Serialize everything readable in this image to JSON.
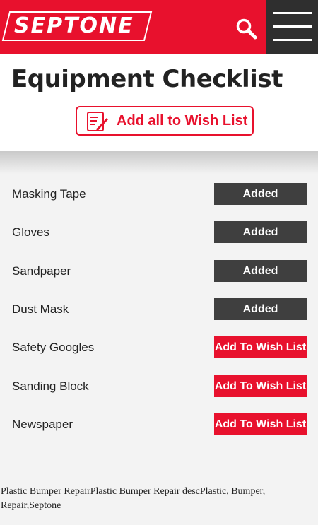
{
  "header": {
    "logo_text": "SEPTONE",
    "search_icon": "search-icon",
    "menu_icon": "hamburger-menu-icon",
    "brand_color": "#e8112d"
  },
  "title": "Equipment Checklist",
  "add_all": {
    "label": "Add all to Wish List",
    "icon": "checklist-pen-icon"
  },
  "items": [
    {
      "name": "Masking Tape",
      "button": "Added",
      "state": "added"
    },
    {
      "name": "Gloves",
      "button": "Added",
      "state": "added"
    },
    {
      "name": "Sandpaper",
      "button": "Added",
      "state": "added"
    },
    {
      "name": "Dust Mask",
      "button": "Added",
      "state": "added"
    },
    {
      "name": "Safety Googles",
      "button": "Add To Wish List",
      "state": "wish"
    },
    {
      "name": "Sanding Block",
      "button": "Add To Wish List",
      "state": "wish"
    },
    {
      "name": "Newspaper",
      "button": "Add To Wish List",
      "state": "wish"
    }
  ],
  "footer_text": "Plastic Bumper RepairPlastic Bumper Repair descPlastic, Bumper, Repair,Septone"
}
